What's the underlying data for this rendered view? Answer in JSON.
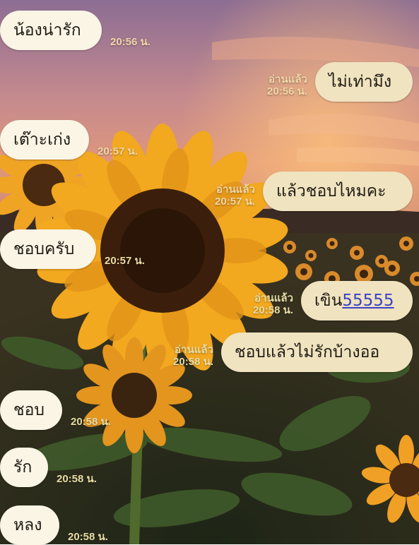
{
  "chat": {
    "messages": [
      {
        "side": "in",
        "text": "น้องน่ารัก",
        "time": "20:56 น."
      },
      {
        "side": "out",
        "text": "ไม่เท่ามึง",
        "read": "อ่านแล้ว",
        "time": "20:56 น."
      },
      {
        "side": "in",
        "text": "เต๊าะเก่ง",
        "time": "20:57 น."
      },
      {
        "side": "out",
        "text": "แล้วชอบไหมคะ",
        "read": "อ่านแล้ว",
        "time": "20:57 น."
      },
      {
        "side": "in",
        "text": "ชอบครับ",
        "time": "20:57 น."
      },
      {
        "side": "out",
        "text": "เขิน",
        "link_text": "55555",
        "read": "อ่านแล้ว",
        "time": "20:58 น."
      },
      {
        "side": "out",
        "text": "ชอบแล้วไม่รักบ้างออ",
        "read": "อ่านแล้ว",
        "time": "20:58 น."
      },
      {
        "side": "in",
        "text": "ชอบ",
        "time": "20:58 น."
      },
      {
        "side": "in",
        "text": "รัก",
        "time": "20:58 น."
      },
      {
        "side": "in",
        "text": "หลง",
        "time": "20:58 น."
      }
    ]
  },
  "colors": {
    "incoming_bubble": "#fbf5e6",
    "outgoing_bubble": "#f0e3c0",
    "meta_text_on_sky": "#f1d6a6",
    "meta_text_on_field": "#e7dca4",
    "link": "#3b43c9"
  },
  "background": {
    "description_icon": "sunflower-field-sunset-wallpaper"
  }
}
